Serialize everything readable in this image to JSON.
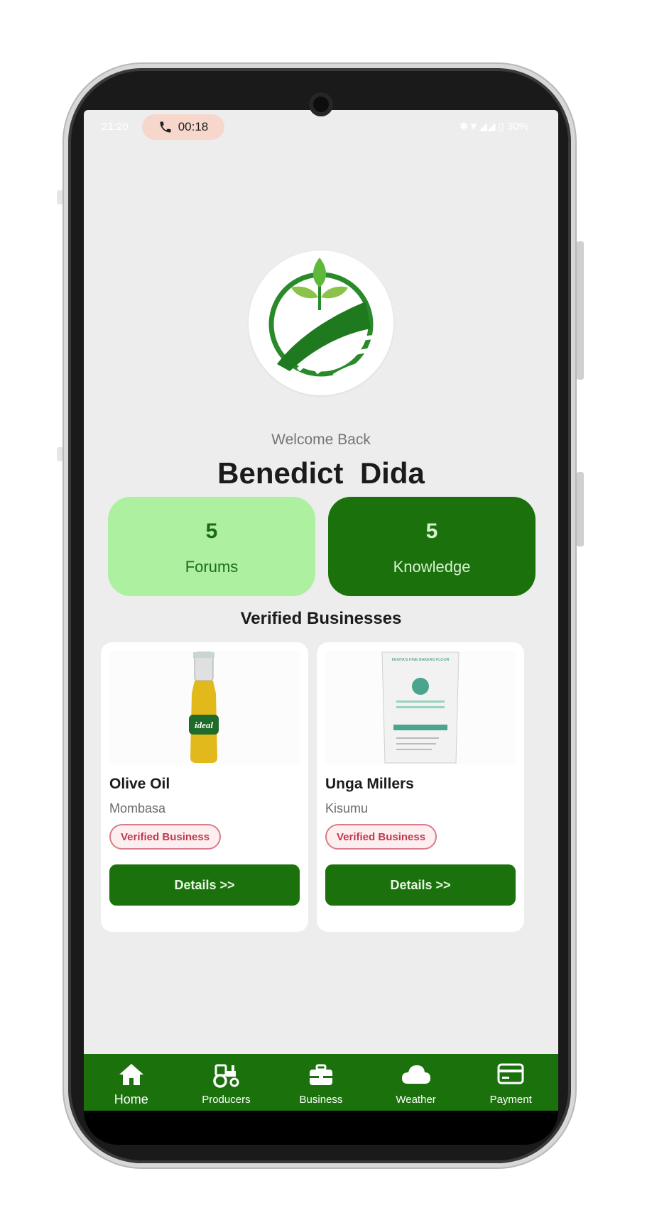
{
  "status_bar": {
    "time": "21:20",
    "call_timer": "00:18",
    "battery": "30%"
  },
  "welcome": {
    "greeting": "Welcome Back",
    "user_name": "Benedict  Dida"
  },
  "stats": [
    {
      "count": "5",
      "label": "Forums"
    },
    {
      "count": "5",
      "label": "Knowledge"
    }
  ],
  "section_title": "Verified Businesses",
  "businesses": [
    {
      "name": "Olive Oil",
      "location": "Mombasa",
      "badge": "Verified Business",
      "button": "Details >>",
      "image_text": "ideal"
    },
    {
      "name": "Unga Millers",
      "location": "Kisumu",
      "badge": "Verified Business",
      "button": "Details >>",
      "image_text": "KENYA'S FINE BAKERS FLOUR"
    }
  ],
  "nav": [
    {
      "label": "Home",
      "icon": "home-icon"
    },
    {
      "label": "Producers",
      "icon": "tractor-icon"
    },
    {
      "label": "Business",
      "icon": "briefcase-icon"
    },
    {
      "label": "Weather",
      "icon": "cloud-icon"
    },
    {
      "label": "Payment",
      "icon": "credit-card-icon"
    }
  ],
  "colors": {
    "primary": "#1b720d",
    "accent_light": "#acf0a0",
    "badge": "#c03a4e",
    "background": "#ededed"
  }
}
